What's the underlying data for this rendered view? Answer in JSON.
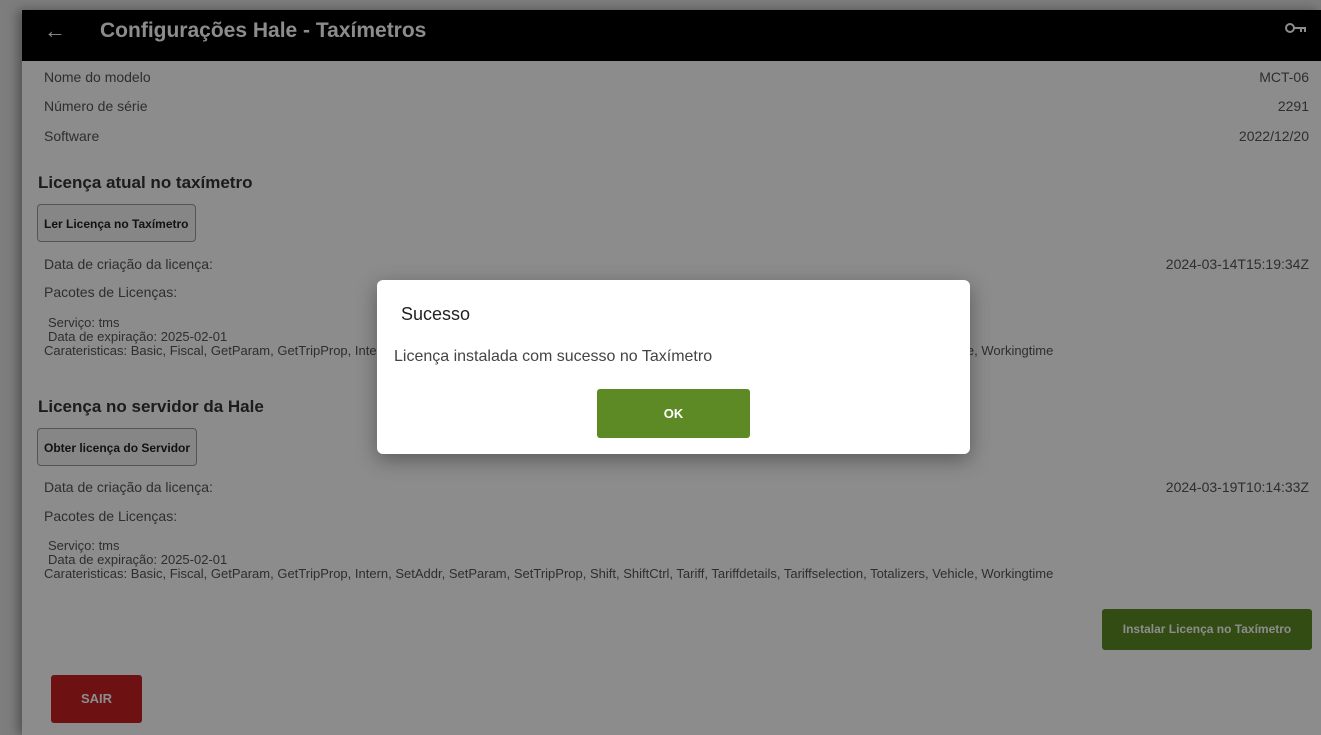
{
  "appbar": {
    "title": "Configurações Hale - Taxímetros"
  },
  "device": {
    "model_label": "Nome do modelo",
    "model_value": "MCT-06",
    "serial_label": "Número de série",
    "serial_value": "2291",
    "software_label": "Software",
    "software_value": "2022/12/20"
  },
  "current": {
    "heading": "Licença atual no taxímetro",
    "read_button": "Ler Licença no Taxímetro",
    "created_label": "Data de criação da licença:",
    "created_value": "2024-03-14T15:19:34Z",
    "packages_label": "Pacotes de Licenças:",
    "service": "Serviço: tms",
    "expiry": "Data de expiração: 2025-02-01",
    "features": "Carateristicas: Basic, Fiscal, GetParam, GetTripProp, Intern, SetAddr, SetParam, SetTripProp, Shift, ShiftCtrl, Tariff, Tariffdetails, Tariffselection, Totalizers, Vehicle, Workingtime"
  },
  "server": {
    "heading": "Licença no servidor da Hale",
    "get_button": "Obter licença do Servidor",
    "created_label": "Data de criação da licença:",
    "created_value": "2024-03-19T10:14:33Z",
    "packages_label": "Pacotes de Licenças:",
    "service": "Serviço: tms",
    "expiry": "Data de expiração: 2025-02-01",
    "features": "Carateristicas: Basic, Fiscal, GetParam, GetTripProp, Intern, SetAddr, SetParam, SetTripProp, Shift, ShiftCtrl, Tariff, Tariffdetails, Tariffselection, Totalizers, Vehicle, Workingtime"
  },
  "actions": {
    "install_button": "Instalar Licença no Taxímetro",
    "exit_button": "SAIR"
  },
  "dialog": {
    "title": "Sucesso",
    "message": "Licença instalada com sucesso no Taxímetro",
    "ok_button": "OK"
  },
  "colors": {
    "appbar": "#000000",
    "accent_green": "#5e8a25",
    "exit_red": "#c71f23"
  },
  "icons": {
    "back": "arrow-left-icon",
    "key": "key-icon"
  }
}
